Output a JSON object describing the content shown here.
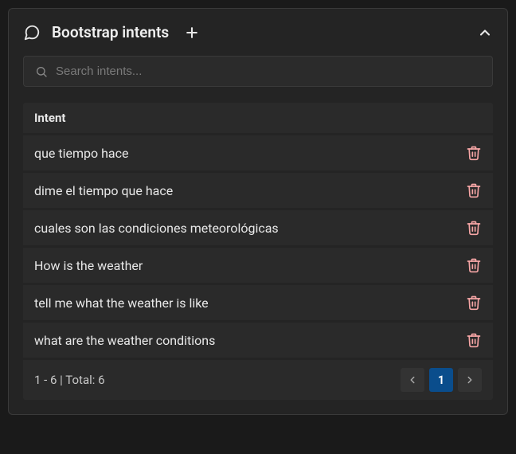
{
  "header": {
    "title": "Bootstrap intents"
  },
  "search": {
    "placeholder": "Search intents...",
    "value": ""
  },
  "table": {
    "column_label": "Intent",
    "rows": [
      {
        "text": "que tiempo hace"
      },
      {
        "text": "dime el tiempo que hace"
      },
      {
        "text": "cuales son las condiciones meteorológicas"
      },
      {
        "text": "How is the weather"
      },
      {
        "text": "tell me what the weather is like"
      },
      {
        "text": "what are the weather conditions"
      }
    ]
  },
  "pagination": {
    "summary": "1 - 6 | Total: 6",
    "current_page": "1"
  }
}
